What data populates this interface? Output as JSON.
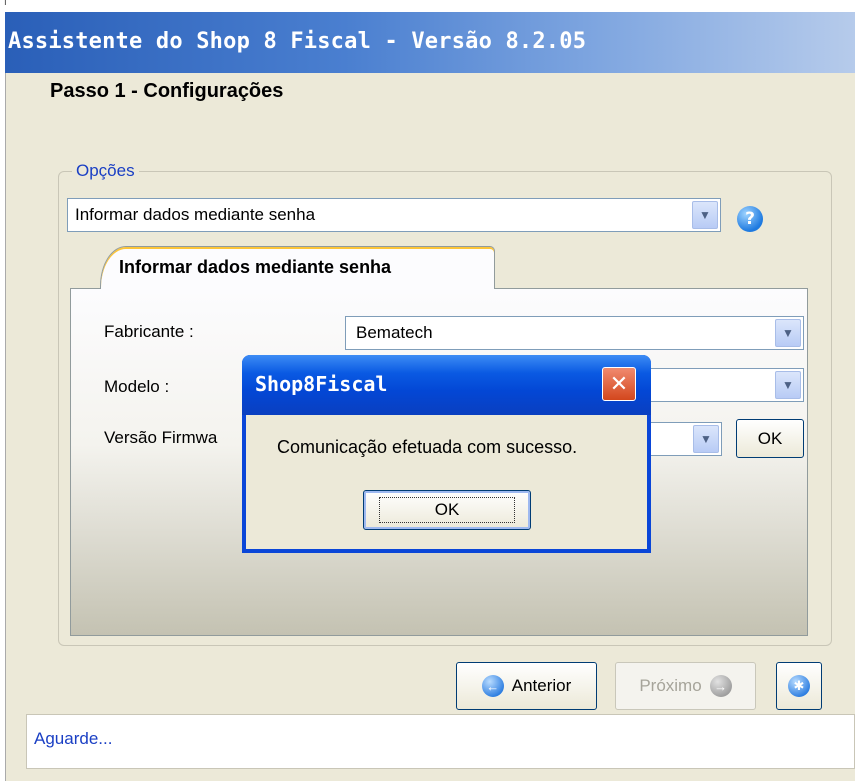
{
  "window": {
    "title": "Assistente do Shop 8 Fiscal - Versão 8.2.05",
    "step_title": "Passo 1 - Configurações"
  },
  "options": {
    "legend": "Opções",
    "selected": "Informar dados mediante senha",
    "help_icon": "question-icon"
  },
  "tab": {
    "label": "Informar dados mediante senha",
    "fields": {
      "fabricante_label": "Fabricante :",
      "fabricante_value": "Bematech",
      "modelo_label": "Modelo :",
      "modelo_value": "",
      "firmware_label": "Versão Firmwa",
      "firmware_value": "",
      "ok_label": "OK"
    }
  },
  "nav": {
    "anterior_label": "Anterior",
    "proximo_label": "Próximo"
  },
  "status": {
    "text": "Aguarde..."
  },
  "dialog": {
    "title": "Shop8Fiscal",
    "message": "Comunicação efetuada com sucesso.",
    "ok_label": "OK"
  }
}
